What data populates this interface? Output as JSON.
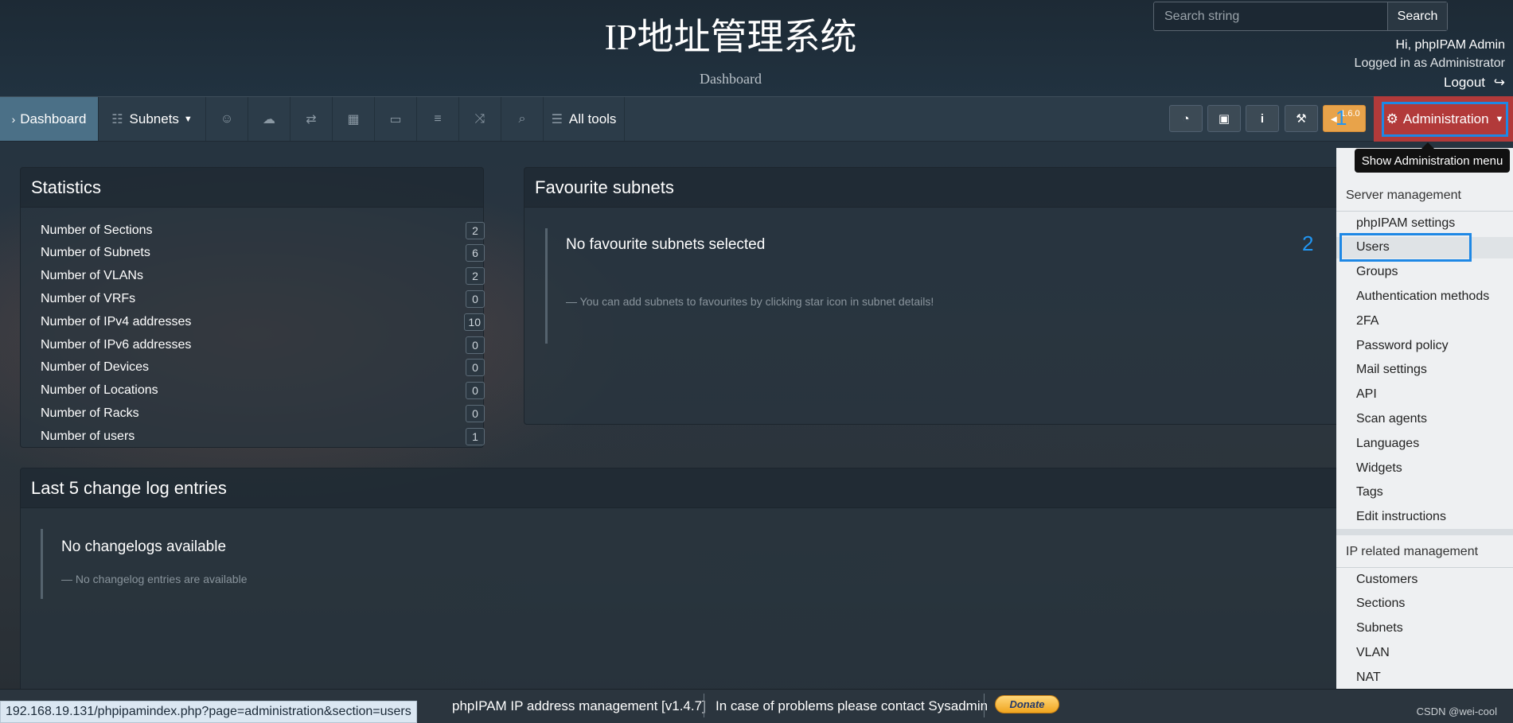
{
  "header": {
    "title": "IP地址管理系统",
    "subtitle": "Dashboard",
    "search": {
      "placeholder": "Search string",
      "button": "Search"
    },
    "user": {
      "greeting": "Hi, phpIPAM Admin",
      "role": "Logged in as  Administrator",
      "logout": "Logout"
    }
  },
  "nav": {
    "dashboard": "Dashboard",
    "subnets": "Subnets",
    "all_tools": "All tools",
    "version_badge": "1.6.0",
    "administration": "Administration"
  },
  "annotations": {
    "step1": "1",
    "step2": "2"
  },
  "tooltip": "Show Administration menu",
  "statistics": {
    "title": "Statistics",
    "rows": [
      {
        "label": "Number of Sections",
        "value": "2"
      },
      {
        "label": "Number of Subnets",
        "value": "6"
      },
      {
        "label": "Number of VLANs",
        "value": "2"
      },
      {
        "label": "Number of VRFs",
        "value": "0"
      },
      {
        "label": "Number of IPv4 addresses",
        "value": "10"
      },
      {
        "label": "Number of IPv6 addresses",
        "value": "0"
      },
      {
        "label": "Number of Devices",
        "value": "0"
      },
      {
        "label": "Number of Locations",
        "value": "0"
      },
      {
        "label": "Number of Racks",
        "value": "0"
      },
      {
        "label": "Number of users",
        "value": "1"
      }
    ]
  },
  "favourites": {
    "title": "Favourite subnets",
    "empty": "No favourite subnets selected",
    "hint": "— You can add subnets to favourites by clicking star icon in subnet details!"
  },
  "changelog": {
    "title": "Last 5 change log entries",
    "empty": "No changelogs available",
    "hint": "— No changelog entries are available"
  },
  "admin_menu": {
    "server_header": "Server management",
    "server_items": [
      "phpIPAM settings",
      "Users",
      "Groups",
      "Authentication methods",
      "2FA",
      "Password policy",
      "Mail settings",
      "API",
      "Scan agents",
      "Languages",
      "Widgets",
      "Tags",
      "Edit instructions"
    ],
    "ip_header": "IP related management",
    "ip_items": [
      "Customers",
      "Sections",
      "Subnets",
      "VLAN",
      "NAT"
    ]
  },
  "footer": {
    "status_url": "192.168.19.131/phpipamindex.php?page=administration&section=users",
    "app_name": "phpIPAM IP address management [v1.4.7]",
    "contact": "In case of problems please contact Sysadmin",
    "donate": "Donate",
    "watermark": "CSDN @wei-cool"
  }
}
